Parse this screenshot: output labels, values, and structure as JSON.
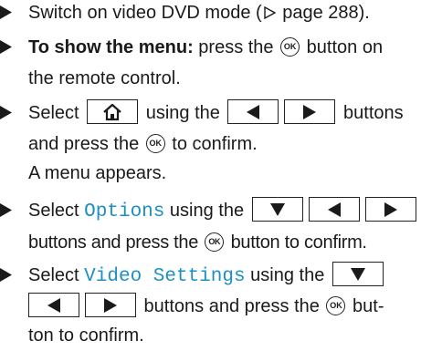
{
  "items": [
    {
      "segments": [
        "Switch on video DVD mode (",
        " page 288)."
      ]
    },
    {
      "bold_label": "To show the menu:",
      "segments": [
        " press the ",
        " button on"
      ],
      "continuation": "the remote control."
    },
    {
      "segments": [
        "Select ",
        " using the ",
        " buttons"
      ],
      "continuation": "and press the ",
      "continuation_end": " to confirm.",
      "result": "A menu appears."
    },
    {
      "segments": [
        "Select ",
        " using the "
      ],
      "highlight": "Options",
      "continuation": "buttons and press the ",
      "continuation_end": " button to confirm."
    },
    {
      "segments": [
        "Select ",
        " using the "
      ],
      "highlight": "Video Settings",
      "continuation_end": " buttons and press the ",
      "continuation_tail": " but-",
      "final": "ton to confirm."
    }
  ],
  "ok_label": "OK",
  "icons": [
    "bullet-triangle-icon",
    "page-reference-icon",
    "ok-button-icon",
    "home-key-icon",
    "left-arrow-key-icon",
    "right-arrow-key-icon",
    "down-arrow-key-icon"
  ]
}
